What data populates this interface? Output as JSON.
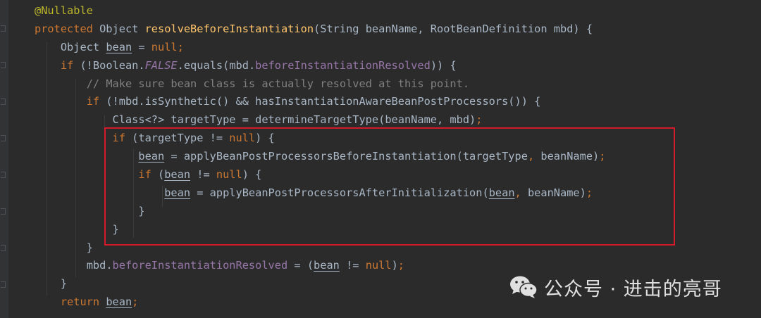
{
  "editor": {
    "theme_colors": {
      "background": "#2b2b2b",
      "default_text": "#a9b7c6",
      "keyword": "#cc7832",
      "annotation": "#bbb529",
      "field": "#9876aa",
      "comment": "#808080",
      "method_declaration": "#ffc66d",
      "highlight_box": "#d11a2a"
    },
    "lines": [
      {
        "indent": 0,
        "tokens": [
          {
            "t": "@Nullable",
            "c": "ann"
          }
        ]
      },
      {
        "indent": 0,
        "tokens": [
          {
            "t": "protected",
            "c": "kw"
          },
          {
            "t": " Object "
          },
          {
            "t": "resolveBeforeInstantiation",
            "c": "fn"
          },
          {
            "t": "(String beanName, RootBeanDefinition mbd) {"
          }
        ]
      },
      {
        "indent": 1,
        "tokens": [
          {
            "t": "Object "
          },
          {
            "t": "bean",
            "c": "var"
          },
          {
            "t": " = "
          },
          {
            "t": "null",
            "c": "kw"
          },
          {
            "t": ";",
            "c": "kw"
          }
        ]
      },
      {
        "indent": 1,
        "tokens": [
          {
            "t": "if",
            "c": "kw"
          },
          {
            "t": " (!Boolean."
          },
          {
            "t": "FALSE",
            "c": "sfld"
          },
          {
            "t": ".equals(mbd."
          },
          {
            "t": "beforeInstantiationResolved",
            "c": "fld"
          },
          {
            "t": ")) {"
          }
        ]
      },
      {
        "indent": 2,
        "tokens": [
          {
            "t": "// Make sure bean class is actually resolved at this point.",
            "c": "cmt"
          }
        ]
      },
      {
        "indent": 2,
        "tokens": [
          {
            "t": "if",
            "c": "kw"
          },
          {
            "t": " (!mbd.isSynthetic() && hasInstantiationAwareBeanPostProcessors()) {"
          }
        ]
      },
      {
        "indent": 3,
        "tokens": [
          {
            "t": "Class<?> targetType = determineTargetType(beanName, mbd)"
          },
          {
            "t": ";",
            "c": "kw"
          }
        ]
      },
      {
        "indent": 3,
        "tokens": [
          {
            "t": "if",
            "c": "kw"
          },
          {
            "t": " (targetType != "
          },
          {
            "t": "null",
            "c": "kw"
          },
          {
            "t": ") {"
          }
        ]
      },
      {
        "indent": 4,
        "tokens": [
          {
            "t": "bean",
            "c": "var"
          },
          {
            "t": " = applyBeanPostProcessorsBeforeInstantiation(targetType"
          },
          {
            "t": ",",
            "c": "kw"
          },
          {
            "t": " beanName)"
          },
          {
            "t": ";",
            "c": "kw"
          }
        ]
      },
      {
        "indent": 4,
        "tokens": [
          {
            "t": "if",
            "c": "kw"
          },
          {
            "t": " ("
          },
          {
            "t": "bean",
            "c": "var"
          },
          {
            "t": " != "
          },
          {
            "t": "null",
            "c": "kw"
          },
          {
            "t": ") {"
          }
        ]
      },
      {
        "indent": 5,
        "tokens": [
          {
            "t": "bean",
            "c": "var"
          },
          {
            "t": " = applyBeanPostProcessorsAfterInitialization("
          },
          {
            "t": "bean",
            "c": "var"
          },
          {
            "t": ",",
            "c": "kw"
          },
          {
            "t": " beanName)"
          },
          {
            "t": ";",
            "c": "kw"
          }
        ]
      },
      {
        "indent": 4,
        "tokens": [
          {
            "t": "}"
          }
        ]
      },
      {
        "indent": 3,
        "tokens": [
          {
            "t": "}"
          }
        ]
      },
      {
        "indent": 2,
        "tokens": [
          {
            "t": "}"
          }
        ]
      },
      {
        "indent": 2,
        "tokens": [
          {
            "t": "mbd."
          },
          {
            "t": "beforeInstantiationResolved",
            "c": "fld"
          },
          {
            "t": " = ("
          },
          {
            "t": "bean",
            "c": "var"
          },
          {
            "t": " != "
          },
          {
            "t": "null",
            "c": "kw"
          },
          {
            "t": ")"
          },
          {
            "t": ";",
            "c": "kw"
          }
        ]
      },
      {
        "indent": 1,
        "tokens": [
          {
            "t": "}"
          }
        ]
      },
      {
        "indent": 1,
        "tokens": [
          {
            "t": "return",
            "c": "kw"
          },
          {
            "t": " "
          },
          {
            "t": "bean",
            "c": "var"
          },
          {
            "t": ";",
            "c": "kw"
          }
        ]
      }
    ]
  },
  "watermark": {
    "icon": "wechat-icon",
    "text": "公众号 · 进击的亮哥"
  }
}
